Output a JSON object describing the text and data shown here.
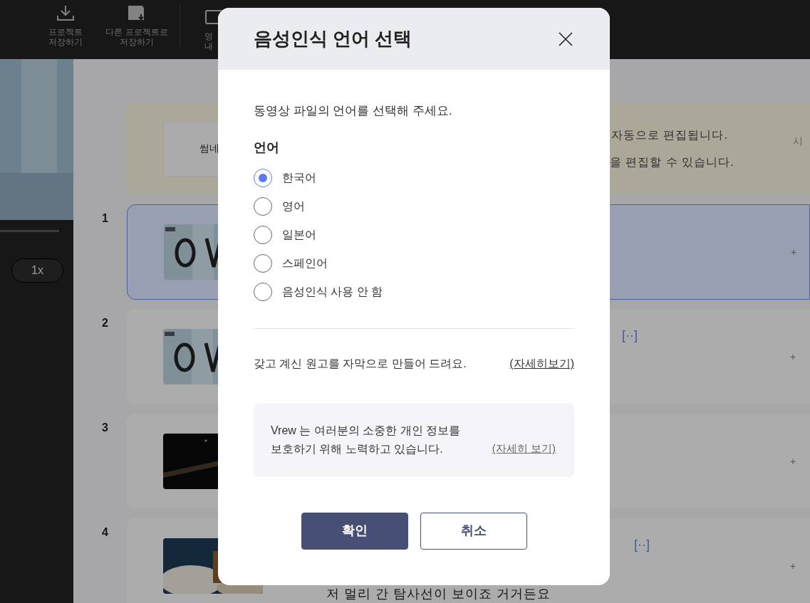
{
  "toolbar": {
    "items": [
      {
        "kind": "download",
        "label": "프로젝트\n저장하기"
      },
      {
        "kind": "clapper",
        "label": "다른 프로젝트로\n저장하기"
      },
      {
        "kind": "export",
        "label": "영\n내"
      }
    ]
  },
  "player": {
    "speed": "1x"
  },
  "intro": {
    "thumbnail_label": "썸네",
    "line_1": "자동으로 편집됩니다.",
    "line_2": "을 편집할 수 있습니다.",
    "side_label": "시"
  },
  "clips": [
    {
      "number": "1",
      "selected": true,
      "kind": "light",
      "add": "+"
    },
    {
      "number": "2",
      "selected": false,
      "kind": "light",
      "marker": "[··]",
      "add": "+"
    },
    {
      "number": "3",
      "selected": false,
      "kind": "dark",
      "add": "+"
    },
    {
      "number": "4",
      "selected": false,
      "kind": "launch",
      "marker": "[··]",
      "add": "+",
      "subtitle": "저 멀리 간 탐사선이 보이죠 거거든요"
    }
  ],
  "dialog": {
    "title": "음성인식 언어 선택",
    "prompt": "동영상 파일의 언어를 선택해 주세요.",
    "group_label": "언어",
    "options": [
      {
        "label": "한국어",
        "selected": true
      },
      {
        "label": "영어",
        "selected": false
      },
      {
        "label": "일본어",
        "selected": false
      },
      {
        "label": "스페인어",
        "selected": false
      },
      {
        "label": "음성인식 사용 안 함",
        "selected": false
      }
    ],
    "script_note": "갖고 계신 원고를 자막으로 만들어 드려요.",
    "script_link": "(자세히보기)",
    "privacy_note": "Vrew 는 여러분의 소중한 개인 정보를\n보호하기 위해 노력하고 있습니다.",
    "privacy_link": "(자세히 보기)",
    "buttons": [
      {
        "kind": "primary",
        "label": "확인"
      },
      {
        "kind": "secondary",
        "label": "취소"
      }
    ]
  }
}
